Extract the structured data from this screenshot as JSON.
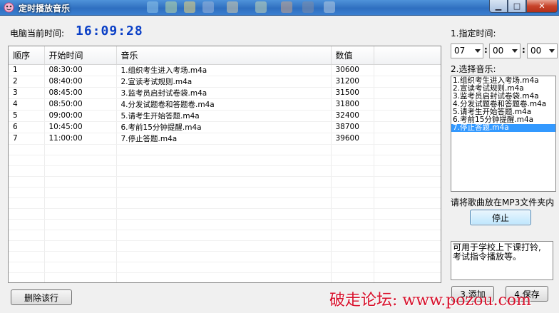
{
  "window": {
    "title": "定时播放音乐",
    "minimize_label": "▁",
    "maximize_label": "□",
    "close_label": "✕"
  },
  "clock": {
    "label": "电脑当前时间:",
    "value": "16:09:28"
  },
  "table": {
    "headers": [
      "顺序",
      "开始时间",
      "音乐",
      "数值",
      ""
    ],
    "rows": [
      {
        "order": "1",
        "time": "08:30:00",
        "music": "1.组织考生进入考场.m4a",
        "value": "30600"
      },
      {
        "order": "2",
        "time": "08:40:00",
        "music": "2.宣读考试规则.m4a",
        "value": "31200"
      },
      {
        "order": "3",
        "time": "08:45:00",
        "music": "3.监考员启封试卷袋.m4a",
        "value": "31500"
      },
      {
        "order": "4",
        "time": "08:50:00",
        "music": "4.分发试题卷和答题卷.m4a",
        "value": "31800"
      },
      {
        "order": "5",
        "time": "09:00:00",
        "music": "5.请考生开始答题.m4a",
        "value": "32400"
      },
      {
        "order": "6",
        "time": "10:45:00",
        "music": "6.考前15分钟提醒.m4a",
        "value": "38700"
      },
      {
        "order": "7",
        "time": "11:00:00",
        "music": "7.停止答题.m4a",
        "value": "39600"
      }
    ]
  },
  "delete_button": "删除该行",
  "right_panel": {
    "time_label": "1.指定时间:",
    "hour": "07",
    "minute": "00",
    "second": "00",
    "separator": ":",
    "music_label": "2.选择音乐:",
    "music_options": [
      "1.组织考生进入考场.m4a",
      "2.宣读考试规则.m4a",
      "3.监考员启封试卷袋.m4a",
      "4.分发试题卷和答题卷.m4a",
      "5.请考生开始答题.m4a",
      "6.考前15分钟提醒.m4a",
      "7.停止答题.m4a"
    ],
    "selected_index": 6,
    "folder_note": "请将歌曲放在MP3文件夹内",
    "stop_button": "停止",
    "memo_line1": "可用于学校上下课打铃,",
    "memo_line2": "考试指令播放等。",
    "add_button": "3.添加",
    "save_button": "4.保存"
  },
  "watermark": "破走论坛: www.pozou.com",
  "colors": {
    "clock": "#0a3fc6",
    "selection": "#3399ff",
    "watermark": "#d8112c",
    "titlebar": "#2f6fc0"
  }
}
